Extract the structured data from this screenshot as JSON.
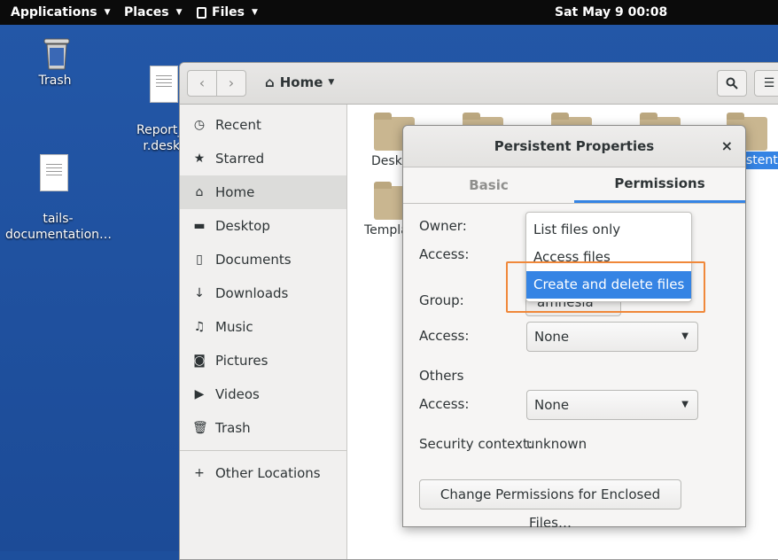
{
  "topbar": {
    "applications": "Applications",
    "places": "Places",
    "files": "Files",
    "clock": "Sat May 9  00:08"
  },
  "desktop": {
    "icons": [
      {
        "label": "Trash"
      },
      {
        "label": "Report_an\nr.deskt"
      },
      {
        "label": "tails-\ndocumentation…"
      }
    ]
  },
  "files_window": {
    "path_label": "Home",
    "sidebar": [
      {
        "label": "Recent",
        "icon": "clock-icon"
      },
      {
        "label": "Starred",
        "icon": "star-icon"
      },
      {
        "label": "Home",
        "icon": "home-icon"
      },
      {
        "label": "Desktop",
        "icon": "folder-icon"
      },
      {
        "label": "Documents",
        "icon": "document-icon"
      },
      {
        "label": "Downloads",
        "icon": "download-icon"
      },
      {
        "label": "Music",
        "icon": "music-icon"
      },
      {
        "label": "Pictures",
        "icon": "camera-icon"
      },
      {
        "label": "Videos",
        "icon": "video-icon"
      },
      {
        "label": "Trash",
        "icon": "trash-icon"
      },
      {
        "label": "Other Locations",
        "icon": "plus-icon"
      }
    ],
    "folders": [
      {
        "label": "Deskt"
      },
      {
        "label": "Templa"
      },
      {
        "label": "stent"
      }
    ]
  },
  "dialog": {
    "title": "Persistent Properties",
    "close": "×",
    "tabs": [
      "Basic",
      "Permissions"
    ],
    "owner_label": "Owner:",
    "access_label": "Access:",
    "group_label": "Group:",
    "group_value": "amnesia",
    "group_access_value": "None",
    "others_label": "Others",
    "others_access_value": "None",
    "security_label": "Security context:",
    "security_value": "unknown",
    "change_button": "Change Permissions for Enclosed Files…",
    "dropdown_options": [
      "List files only",
      "Access files",
      "Create and delete files"
    ],
    "selected_option": "Create and delete files"
  },
  "colors": {
    "accent": "#3584e4",
    "highlight": "#f0883a",
    "desktop": "#1f51a0"
  }
}
